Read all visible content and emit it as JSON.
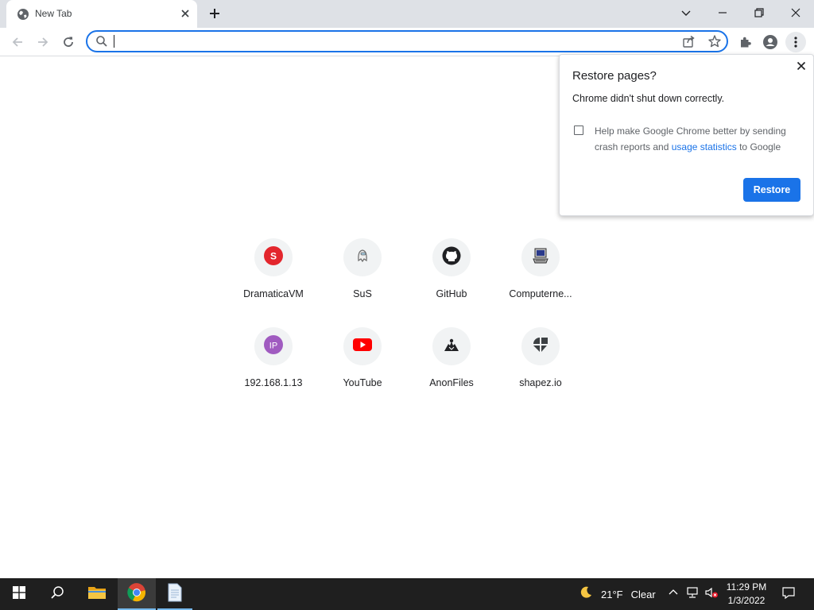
{
  "tabs": [
    {
      "title": "New Tab",
      "favicon": "globe-icon"
    }
  ],
  "omnibox": {
    "value": "",
    "placeholder": ""
  },
  "shortcuts": [
    {
      "label": "DramaticaVM",
      "icon": "letter-s-icon",
      "icon_text": "S",
      "icon_color": "#e3262d"
    },
    {
      "label": "SuS",
      "icon": "sus-logo-icon",
      "icon_text": "",
      "icon_color": "#e8e8e8"
    },
    {
      "label": "GitHub",
      "icon": "github-icon",
      "icon_text": "",
      "icon_color": "#202124"
    },
    {
      "label": "Computerne...",
      "icon": "computer-icon",
      "icon_text": "",
      "icon_color": "#5f6368"
    },
    {
      "label": "192.168.1.13",
      "icon": "ip-icon",
      "icon_text": "IP",
      "icon_color": "#a05bc0"
    },
    {
      "label": "YouTube",
      "icon": "youtube-icon",
      "icon_text": "",
      "icon_color": "#ff0000"
    },
    {
      "label": "AnonFiles",
      "icon": "anonfiles-icon",
      "icon_text": "",
      "icon_color": "#202124"
    },
    {
      "label": "shapez.io",
      "icon": "shapez-icon",
      "icon_text": "",
      "icon_color": "#3c4043"
    }
  ],
  "restore_bubble": {
    "title": "Restore pages?",
    "message": "Chrome didn't shut down correctly.",
    "checkbox_checked": false,
    "checkbox_text_before": "Help make Google Chrome better by sending crash reports and ",
    "checkbox_link": "usage statistics",
    "checkbox_text_after": " to Google",
    "button": "Restore"
  },
  "taskbar": {
    "weather_temp": "21°F",
    "weather_cond": "Clear",
    "time": "11:29 PM",
    "date": "1/3/2022"
  },
  "colors": {
    "accent": "#1a73e8",
    "tabstrip": "#dee1e6",
    "taskbar": "#1f1f1f"
  }
}
